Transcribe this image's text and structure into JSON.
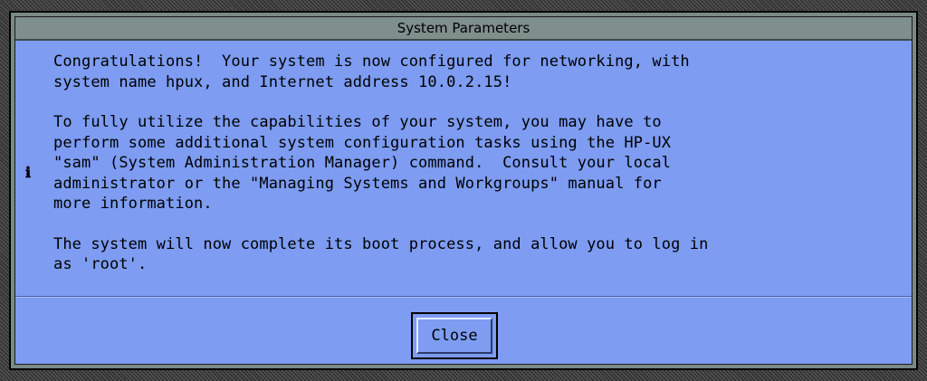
{
  "dialog": {
    "title": "System Parameters",
    "paragraphs": [
      "Congratulations!  Your system is now configured for networking, with\nsystem name hpux, and Internet address 10.0.2.15!",
      "To fully utilize the capabilities of your system, you may have to\nperform some additional system configuration tasks using the HP-UX\n\"sam\" (System Administration Manager) command.  Consult your local\nadministrator or the \"Managing Systems and Workgroups\" manual for\nmore information.",
      "The system will now complete its boot process, and allow you to log in\nas 'root'."
    ],
    "icon": "info-icon",
    "close_label": "Close"
  }
}
